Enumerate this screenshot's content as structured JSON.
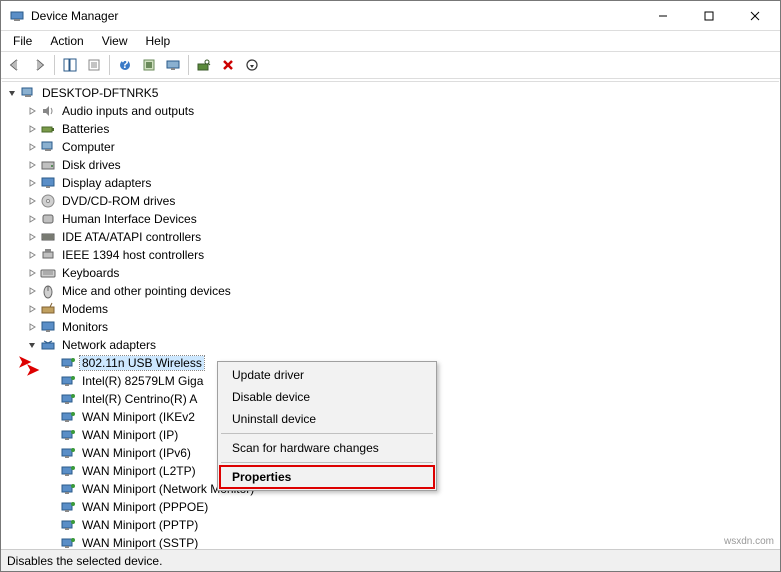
{
  "window": {
    "title": "Device Manager"
  },
  "menubar": [
    "File",
    "Action",
    "View",
    "Help"
  ],
  "toolbar_icons": [
    "back-icon",
    "forward-icon",
    "sep",
    "show-hide-icon",
    "properties-icon",
    "sep",
    "help-icon",
    "event-viewer-icon",
    "monitor-icon",
    "sep",
    "scan-icon",
    "delete-icon",
    "enable-icon"
  ],
  "root": "DESKTOP-DFTNRK5",
  "categories": [
    {
      "label": "Audio inputs and outputs",
      "expanded": false,
      "icon": "audio"
    },
    {
      "label": "Batteries",
      "expanded": false,
      "icon": "battery"
    },
    {
      "label": "Computer",
      "expanded": false,
      "icon": "computer"
    },
    {
      "label": "Disk drives",
      "expanded": false,
      "icon": "disk"
    },
    {
      "label": "Display adapters",
      "expanded": false,
      "icon": "display"
    },
    {
      "label": "DVD/CD-ROM drives",
      "expanded": false,
      "icon": "dvd"
    },
    {
      "label": "Human Interface Devices",
      "expanded": false,
      "icon": "hid"
    },
    {
      "label": "IDE ATA/ATAPI controllers",
      "expanded": false,
      "icon": "ide"
    },
    {
      "label": "IEEE 1394 host controllers",
      "expanded": false,
      "icon": "ieee"
    },
    {
      "label": "Keyboards",
      "expanded": false,
      "icon": "keyboard"
    },
    {
      "label": "Mice and other pointing devices",
      "expanded": false,
      "icon": "mouse"
    },
    {
      "label": "Modems",
      "expanded": false,
      "icon": "modem"
    },
    {
      "label": "Monitors",
      "expanded": false,
      "icon": "monitor"
    },
    {
      "label": "Network adapters",
      "expanded": true,
      "icon": "net",
      "children": [
        {
          "label": "802.11n USB Wireless",
          "selected": true
        },
        {
          "label": "Intel(R) 82579LM Giga"
        },
        {
          "label": "Intel(R) Centrino(R) A"
        },
        {
          "label": "WAN Miniport (IKEv2"
        },
        {
          "label": "WAN Miniport (IP)"
        },
        {
          "label": "WAN Miniport (IPv6)"
        },
        {
          "label": "WAN Miniport (L2TP)"
        },
        {
          "label": "WAN Miniport (Network Monitor)"
        },
        {
          "label": "WAN Miniport (PPPOE)"
        },
        {
          "label": "WAN Miniport (PPTP)"
        },
        {
          "label": "WAN Miniport (SSTP)"
        }
      ]
    }
  ],
  "context_menu": {
    "items": [
      "Update driver",
      "Disable device",
      "Uninstall device",
      "sep",
      "Scan for hardware changes",
      "sep",
      "Properties"
    ],
    "highlight_index": 6
  },
  "statusbar": "Disables the selected device.",
  "watermark": "wsxdn.com"
}
